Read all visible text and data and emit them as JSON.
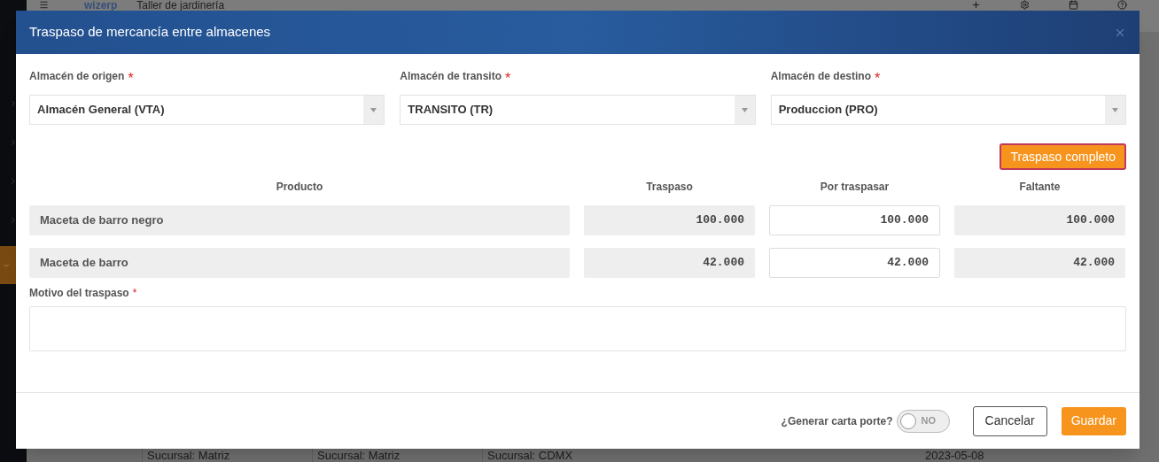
{
  "background": {
    "app_name": "wizerp",
    "page_title": "Taller de jardinería",
    "table_row": [
      "Sucursal: Matriz",
      "Sucursal: Matriz",
      "Sucursal: CDMX",
      "2023-05-08"
    ]
  },
  "modal": {
    "title": "Traspaso de mercancía entre almacenes",
    "selects": [
      {
        "label": "Almacén de origen",
        "required_mark": "*",
        "value": "Almacén General (VTA)"
      },
      {
        "label": "Almacén de transito",
        "required_mark": "*",
        "value": "TRANSITO (TR)"
      },
      {
        "label": "Almacén de destino",
        "required_mark": "*",
        "value": "Produccion (PRO)"
      }
    ],
    "full_transfer_button": "Traspaso completo",
    "columns": [
      "Producto",
      "Traspaso",
      "Por traspasar",
      "Faltante"
    ],
    "rows": [
      {
        "product": "Maceta de barro negro",
        "transfer": "100.000",
        "pending": "100.000",
        "missing": "100.000"
      },
      {
        "product": "Maceta de barro",
        "transfer": "42.000",
        "pending": "42.000",
        "missing": "42.000"
      }
    ],
    "reason": {
      "label": "Motivo del traspaso",
      "required_mark": "*"
    },
    "carta_porte": {
      "label": "¿Generar carta porte?",
      "on": false,
      "state_text": "NO"
    },
    "buttons": {
      "cancel": "Cancelar",
      "save": "Guardar"
    }
  }
}
